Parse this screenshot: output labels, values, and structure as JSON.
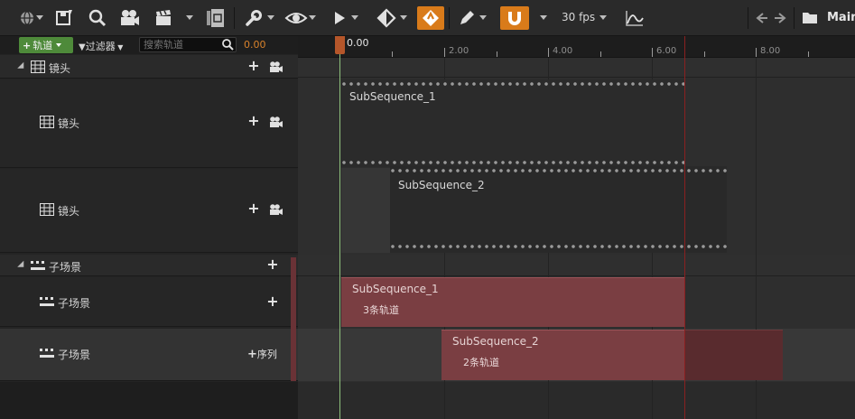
{
  "toolbar": {
    "fps": "30 fps",
    "main": "Main",
    "accent_orange": "#d97b1a"
  },
  "filterbar": {
    "track_button": "轨道",
    "filter_label": "过滤器",
    "search_placeholder": "搜索轨道",
    "current_time": "0.00"
  },
  "tracks": {
    "camera_group": {
      "label": "镜头"
    },
    "camera_1": {
      "label": "镜头"
    },
    "camera_2": {
      "label": "镜头"
    },
    "subscene_group": {
      "label": "子场景"
    },
    "subscene_1": {
      "label": "子场景"
    },
    "subscene_2": {
      "label": "子场景",
      "add_label": "序列"
    }
  },
  "ruler": {
    "playhead": "0.00",
    "ticks": [
      "2.00",
      "4.00",
      "6.00",
      "8.00"
    ]
  },
  "shots": [
    {
      "name": "SubSequence_1"
    },
    {
      "name": "SubSequence_2"
    }
  ],
  "subsequences": [
    {
      "name": "SubSequence_1",
      "tracks": "3条轨道"
    },
    {
      "name": "SubSequence_2",
      "tracks": "2条轨道"
    }
  ],
  "colors": {
    "subsequence_fill": "#7a3e42",
    "playhead": "#b5562a",
    "playhead_line": "#8ec07c",
    "end_marker": "#8a2020",
    "add_track_green": "#4e8a3a"
  }
}
